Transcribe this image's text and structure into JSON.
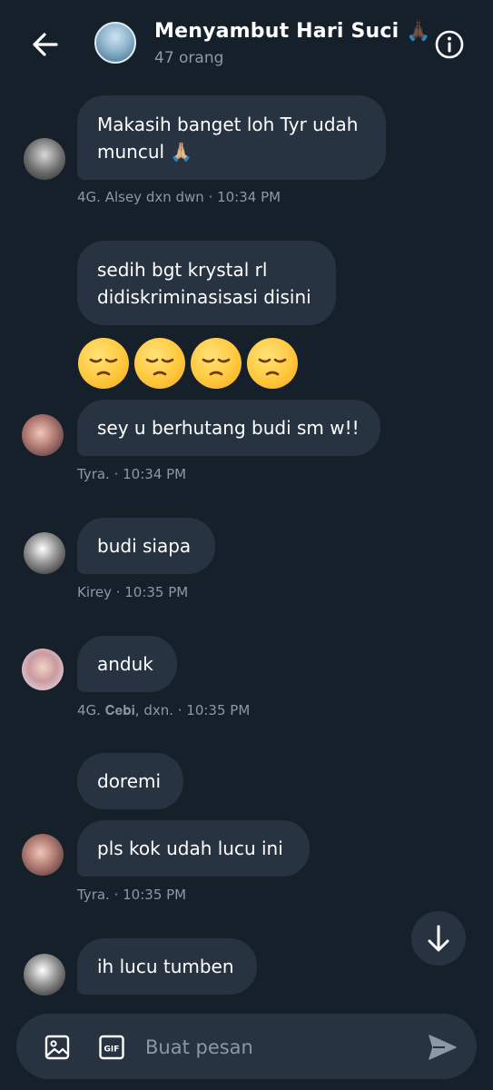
{
  "header": {
    "title": "Menyambut Hari Suci 🙏🏿",
    "member_count": "47 orang"
  },
  "messages": [
    {
      "text": "Makasih banget loh Tyr udah muncul 🙏🏼",
      "meta": "4G. Alsey dxn dwn · 10:34 PM"
    },
    {
      "text": "sedih bgt krystal rl didiskriminasisasi disini"
    },
    {
      "text": "😔😔😔😔"
    },
    {
      "text": "sey u berhutang budi sm w!!",
      "meta": "Tyra. · 10:34 PM"
    },
    {
      "text": "budi siapa",
      "meta": "Kirey · 10:35 PM"
    },
    {
      "text": "anduk",
      "meta": "4G. 𝐂𝐞𝐛𝐢, dxn. · 10:35 PM"
    },
    {
      "text": "doremi"
    },
    {
      "text": "pls kok udah lucu ini",
      "meta": "Tyra. · 10:35 PM"
    },
    {
      "text": "ih lucu tumben"
    }
  ],
  "composer": {
    "placeholder": "Buat pesan"
  },
  "colors": {
    "background": "#15202b",
    "bubble": "#273340",
    "muted_text": "#8b98a5"
  },
  "icons": [
    "back-arrow-icon",
    "info-icon",
    "image-icon",
    "gif-icon",
    "send-icon",
    "arrow-down-icon"
  ]
}
